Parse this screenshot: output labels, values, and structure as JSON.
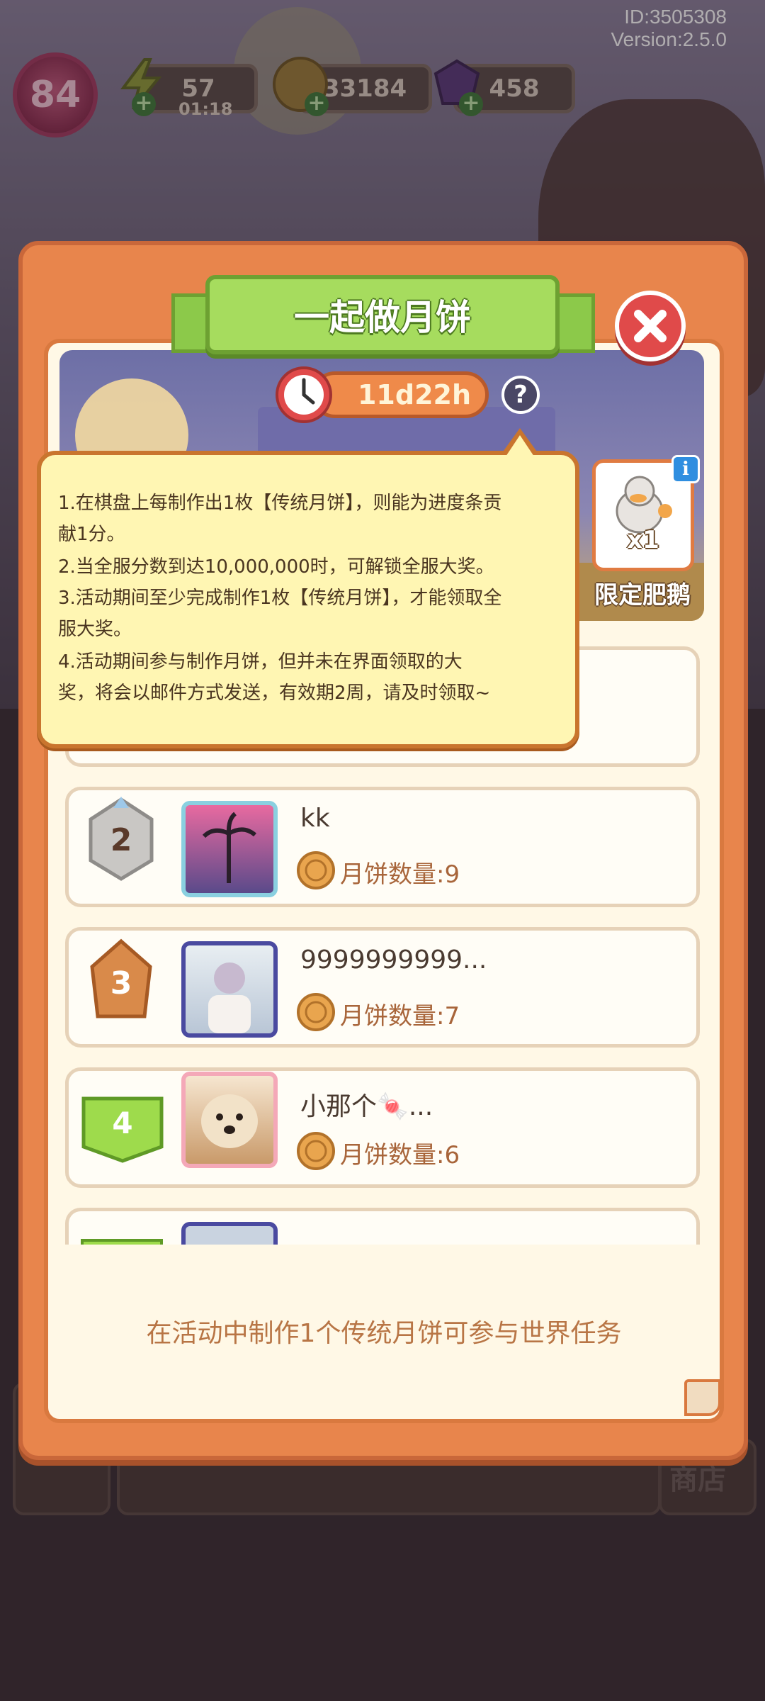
{
  "hud": {
    "player_id": "ID:3505308",
    "version": "Version:2.5.0",
    "level": "84",
    "energy": "57",
    "energy_timer": "01:18",
    "gold": "33184",
    "gems": "458",
    "plus_icon": "plus-icon"
  },
  "modal": {
    "title": "一起做月饼",
    "timer": "11d22h",
    "help": "?",
    "close_icon": "close-icon"
  },
  "reward": {
    "count": "x1",
    "name": "限定肥鹅",
    "info_icon": "i"
  },
  "tooltip": {
    "lines": [
      "1.在棋盘上每制作出1枚【传统月饼】，则能为进度条贡",
      "献1分。",
      "2.当全服分数到达10,000,000时，可解锁全服大奖。",
      "3.活动期间至少完成制作1枚【传统月饼】，才能领取全",
      "服大奖。",
      "4.活动期间参与制作月饼，但并未在界面领取的大",
      "奖，将会以邮件方式发送，有效期2周，请及时领取~"
    ]
  },
  "leaderboard": [
    {
      "rank": "2",
      "name": "kk",
      "count_label": "月饼数量:9"
    },
    {
      "rank": "3",
      "name": "9999999999...",
      "count_label": "月饼数量:7"
    },
    {
      "rank": "4",
      "name": "小那个🍬...",
      "count_label": "月饼数量:6"
    }
  ],
  "footer": {
    "text": "在活动中制作1个传统月饼可参与世界任务"
  },
  "background": {
    "shop_label": "商店"
  },
  "colors": {
    "modal_orange": "#e8854c",
    "title_green": "#a6dc5e",
    "close_red": "#e04a4a",
    "tooltip_yellow": "#fff6b3"
  }
}
